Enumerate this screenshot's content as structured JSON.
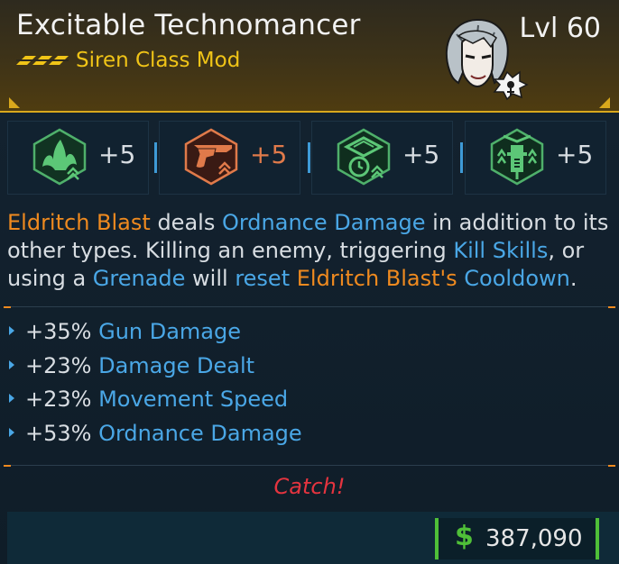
{
  "item": {
    "name": "Excitable Technomancer",
    "type": "Siren Class Mod",
    "level": "Lvl 60",
    "colors": {
      "legendary": "#f0c417",
      "header_border": "#d9a81c"
    }
  },
  "skills": [
    {
      "icon": "leaf-burst-icon",
      "bonus": "+5",
      "theme": "green"
    },
    {
      "icon": "pistol-icon",
      "bonus": "+5",
      "theme": "orange"
    },
    {
      "icon": "timer-shield-icon",
      "bonus": "+5",
      "theme": "green"
    },
    {
      "icon": "syringe-arrows-icon",
      "bonus": "+5",
      "theme": "green"
    }
  ],
  "description": {
    "p1": "Eldritch Blast",
    "p2": " deals ",
    "p3": "Ordnance Damage",
    "p4": " in addition to its other types. Killing an enemy, triggering ",
    "p5": "Kill Skills",
    "p6": ", or using a ",
    "p7": "Grenade",
    "p8": " will ",
    "p9": "reset",
    "p10": " ",
    "p11": "Eldritch Blast's",
    "p12": " ",
    "p13": "Cooldown",
    "p14": "."
  },
  "stats": [
    {
      "value": "+35%",
      "name": "Gun Damage"
    },
    {
      "value": "+23%",
      "name": "Damage Dealt"
    },
    {
      "value": "+23%",
      "name": "Movement Speed"
    },
    {
      "value": "+53%",
      "name": "Ordnance Damage"
    }
  ],
  "flavor": "Catch!",
  "price": {
    "symbol": "$",
    "amount": "387,090"
  }
}
